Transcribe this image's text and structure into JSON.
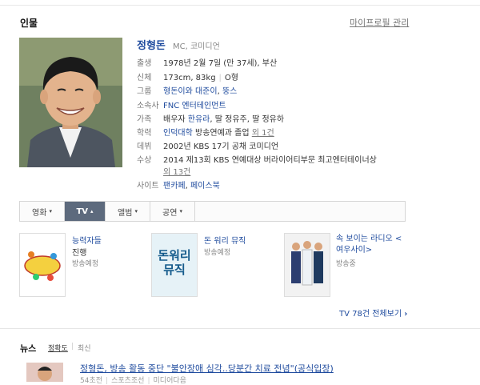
{
  "section": {
    "title": "인물",
    "manage_link": "마이프로필 관리"
  },
  "person": {
    "name": "정형돈",
    "role": "MC, 코미디언",
    "rows": [
      {
        "label": "출생",
        "value": "1978년 2월 7일 (만 37세), 부산"
      },
      {
        "label": "신체",
        "value": "173cm, 83kg",
        "extra": "O형"
      },
      {
        "label": "그룹",
        "links": [
          "형돈이와 대준이",
          "뚱스"
        ]
      },
      {
        "label": "소속사",
        "links": [
          "FNC 엔터테인먼트"
        ]
      },
      {
        "label": "가족",
        "prefix": "배우자 ",
        "link": "한유라",
        "suffix": ", 딸 정유주, 딸 정유하"
      },
      {
        "label": "학력",
        "link": "인덕대학",
        "value": " 방송연예과 졸업",
        "more": "외 1건"
      },
      {
        "label": "데뷔",
        "value": "2002년 KBS 17기 공채 코미디언"
      },
      {
        "label": "수상",
        "value": "2014 제13회 KBS 연예대상 버라이어티부문 최고엔터테이너상",
        "more": "외 13건"
      },
      {
        "label": "사이트",
        "links": [
          "팬카페",
          "페이스북"
        ]
      }
    ]
  },
  "tabs": [
    {
      "label": "영화",
      "caret": "▾",
      "active": false
    },
    {
      "label": "TV",
      "caret": "▴",
      "active": true
    },
    {
      "label": "앨범",
      "caret": "▾",
      "active": false
    },
    {
      "label": "공연",
      "caret": "▾",
      "active": false
    }
  ],
  "programs": [
    {
      "title": "능력자들",
      "sub": "진행",
      "status": "방송예정"
    },
    {
      "title": "돈 워리 뮤직",
      "status": "방송예정",
      "thumb_text": "돈워리 뮤직"
    },
    {
      "title": "속 보이는 라디오 < 여우사이>",
      "status": "방송중"
    }
  ],
  "more_link": "TV 78건 전체보기",
  "news": {
    "title": "뉴스",
    "sort": [
      "정확도",
      "최신"
    ],
    "headline": "정형돈, 방송 활동 중단 \"불안장애 심각..당분간 치료 전념\"(공식입장)",
    "meta": [
      "54초전",
      "스포츠조선",
      "미디어다음"
    ]
  },
  "colors": {
    "link": "#1f4b9e",
    "tab_active": "#5d6a7d"
  }
}
